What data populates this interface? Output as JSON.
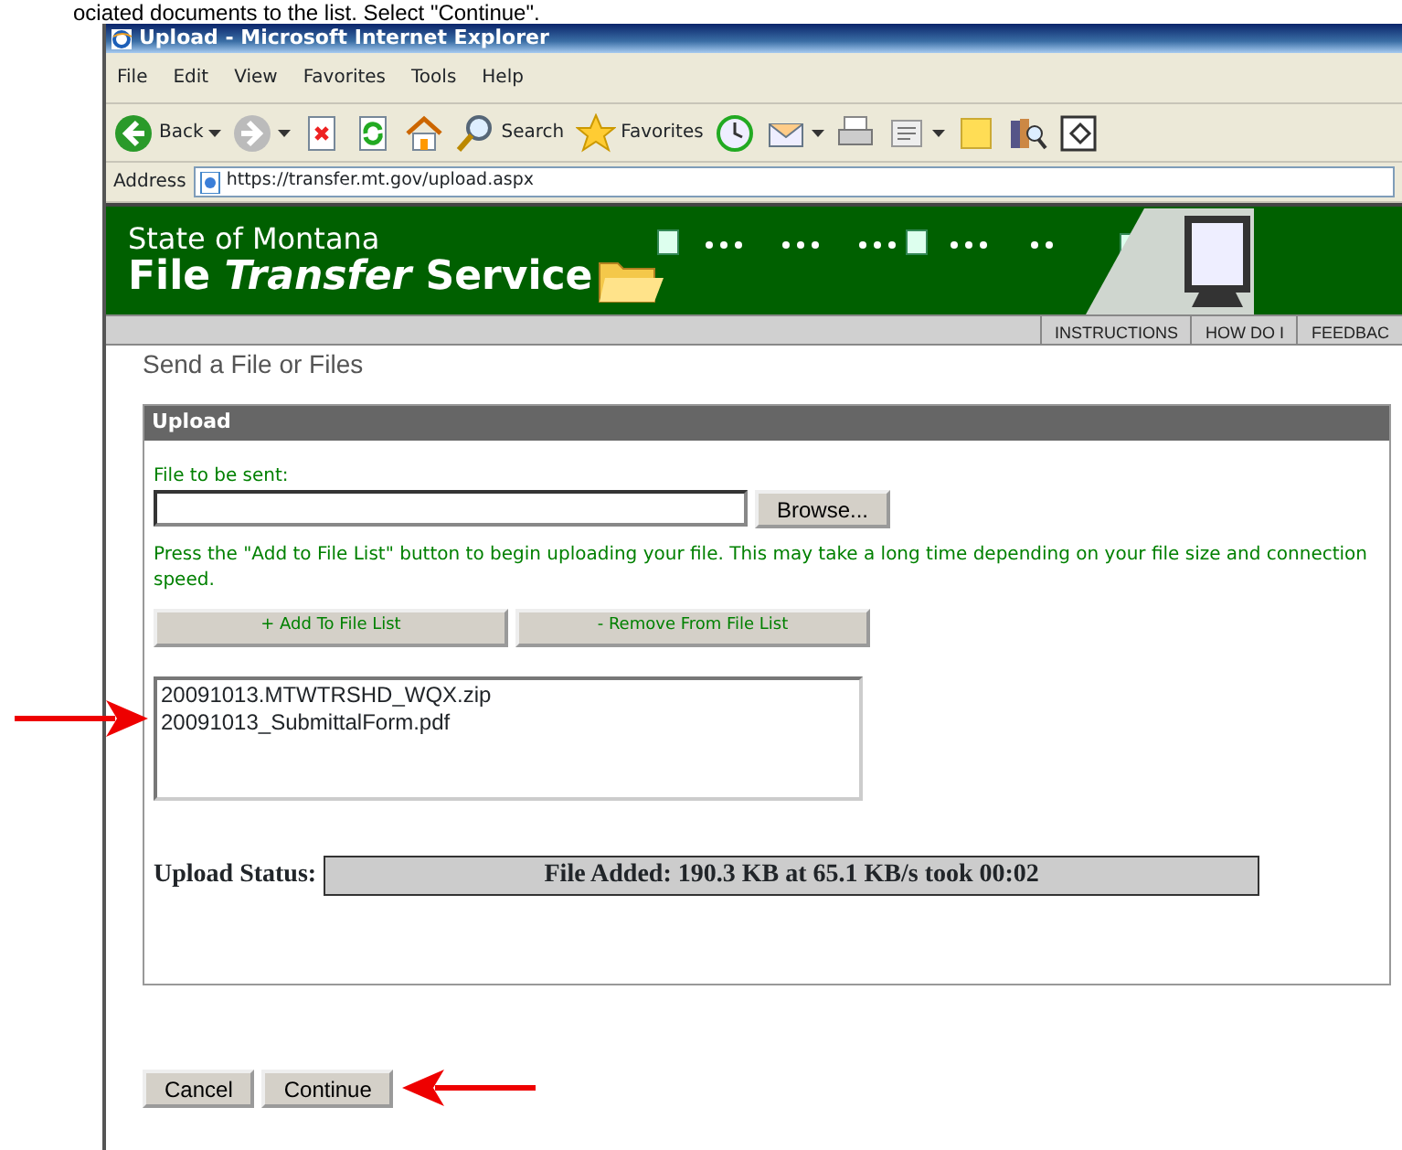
{
  "caption": "ociated documents to the list.  Select \"Continue\".",
  "window": {
    "title": "Upload - Microsoft Internet Explorer"
  },
  "menu": [
    "File",
    "Edit",
    "View",
    "Favorites",
    "Tools",
    "Help"
  ],
  "toolbar": [
    {
      "kind": "back",
      "label": "Back",
      "dropdown": true
    },
    {
      "kind": "forward",
      "dropdown": true
    },
    {
      "kind": "stop"
    },
    {
      "kind": "refresh"
    },
    {
      "kind": "home"
    },
    {
      "kind": "search",
      "label": "Search"
    },
    {
      "kind": "favorites",
      "label": "Favorites"
    },
    {
      "kind": "history"
    },
    {
      "kind": "mail",
      "dropdown": true
    },
    {
      "kind": "print"
    },
    {
      "kind": "word",
      "dropdown": true
    },
    {
      "kind": "note"
    },
    {
      "kind": "research"
    },
    {
      "kind": "toggle"
    }
  ],
  "address": {
    "label": "Address",
    "value": "https://transfer.mt.gov/upload.aspx"
  },
  "banner": {
    "line1": "State of Montana",
    "line2": "File *Transfer* Service"
  },
  "nav": [
    "INSTRUCTIONS",
    "HOW DO I",
    "FEEDBAC"
  ],
  "heading": "Send a File or Files",
  "panel": {
    "title": "Upload",
    "file_label": "File to be sent:",
    "browse": "Browse...",
    "note": "Press the \"Add to File List\" button to begin uploading your file. This may take a long time depending on your file size and connection speed.",
    "add": "+ Add To File List",
    "remove": "- Remove From File List",
    "files": [
      "20091013.MTWTRSHD_WQX.zip",
      "20091013_SubmittalForm.pdf"
    ],
    "status_label": "Upload Status:",
    "status": "File Added: 190.3 KB at 65.1 KB/s took 00:02"
  },
  "buttons": [
    "Cancel",
    "Continue"
  ]
}
